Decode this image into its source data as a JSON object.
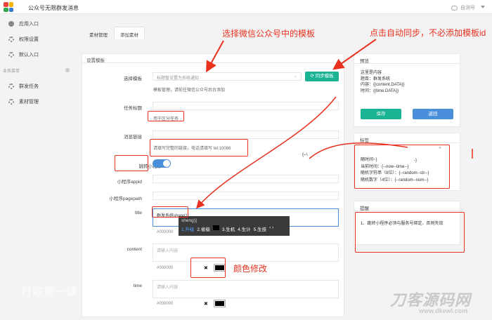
{
  "app": {
    "title": "公众号无限群发消息",
    "user": "自测号"
  },
  "colors": {
    "accent": "#1ab394",
    "blue": "#4a8fd9",
    "annotation": "#e8321e",
    "ime_selected": "#4ea0ff"
  },
  "sidebar": {
    "items": [
      {
        "label": "应用入口",
        "icon": "circle-icon"
      },
      {
        "label": "权限设置",
        "icon": "gear-icon"
      },
      {
        "label": "默认入口",
        "icon": "gear-icon"
      }
    ],
    "section": "业务菜单",
    "biz_items": [
      {
        "label": "群发任务",
        "icon": "gear-icon"
      },
      {
        "label": "素材管理",
        "icon": "gear-icon"
      }
    ]
  },
  "tabs": [
    {
      "label": "素材管理",
      "active": false
    },
    {
      "label": "添加素材",
      "active": true
    }
  ],
  "form": {
    "header": "设置模板",
    "template_label": "选择模板",
    "template_placeholder": "标题暂设置为系统通知",
    "template_hint": "模板管理，请前往微信公众号后台添加",
    "sync_button": "同步模板",
    "task_title_label": "任务标题",
    "task_title_hint": "用于区分任务",
    "link_label": "消息链接",
    "link_hint": "请填写完整的链接，电话请填写 tel:10086",
    "miniprogram_label": "跳转小程序",
    "miniprogram_on": true,
    "appid_label": "小程序appid",
    "pagepath_label": "小程序pagepath",
    "title_label": "title",
    "title_value": "群发系统sheng'|",
    "title_color": "#000000",
    "content_label": "content",
    "content_placeholder": "请输入内容",
    "content_color": "#000000",
    "time_label": "time",
    "time_placeholder": "请输入内容",
    "time_color": "#000000"
  },
  "ime": {
    "pinyin": "sheng'j|",
    "candidates": [
      "1.升级",
      "2.省级",
      "3.生机",
      "4.生计",
      "5.生技"
    ],
    "nav": "‹ ›"
  },
  "preview": {
    "header": "预览",
    "lines": [
      "这里是内容",
      "题目：群发系统",
      "内容：{{content.DATA}}",
      "时间：{{time.DATA}}"
    ],
    "save": "保存",
    "back": "返回"
  },
  "tags": {
    "header": "标签",
    "lines": [
      "随时间~}",
      "当前时间：{--now--time--}",
      "随机字符串（8位）：{--random--str--}",
      "随机数字（4位）：{--random--num--}"
    ],
    "fragment_a": "{--\\",
    "fragment_b": "-}"
  },
  "reminder": {
    "header": "提醒",
    "text": "1、跳转小程序必须与服务号绑定，否则失效"
  },
  "annotations": {
    "select_template": "选择微信公众号中的模板",
    "auto_sync": "点击自动同步，不必添加模板id",
    "color_edit": "颜色修改"
  },
  "watermark": {
    "brand": "刀客源码网",
    "url": "www.dkewl.com",
    "left": "打败第一课"
  }
}
